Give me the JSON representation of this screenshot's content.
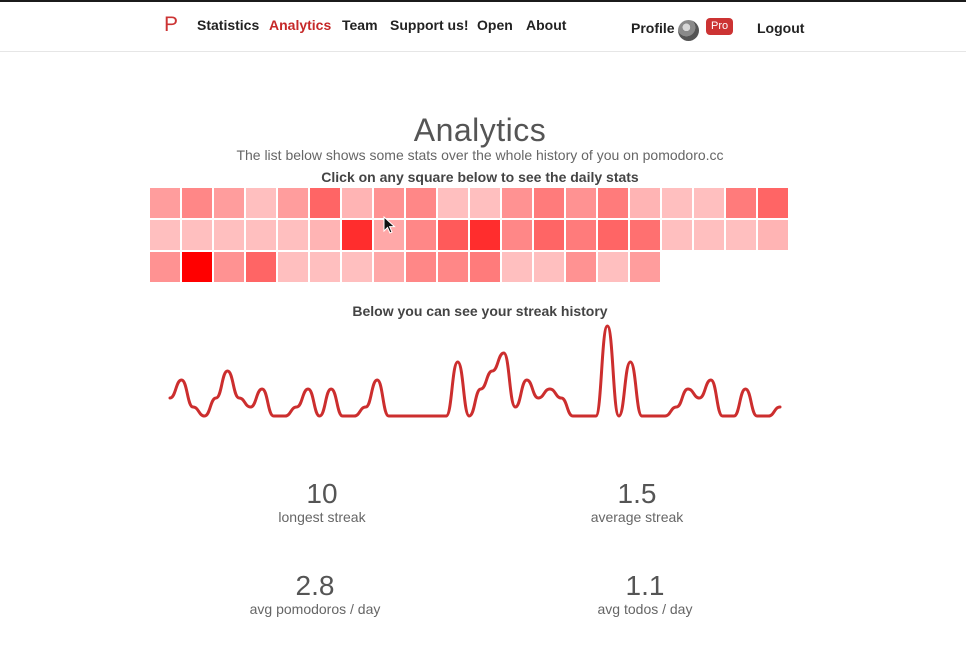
{
  "nav": {
    "logo": "P",
    "items": [
      "Statistics",
      "Analytics",
      "Team",
      "Support us!",
      "Open",
      "About"
    ],
    "active": "Analytics",
    "profile_label": "Profile",
    "pro_badge": "Pro",
    "logout_label": "Logout"
  },
  "page": {
    "title": "Analytics",
    "subtitle": "The list below shows some stats over the whole history of you on pomodoro.cc",
    "instruction": "Click on any square below to see the daily stats",
    "streak_title": "Below you can see your streak history"
  },
  "heatmap": {
    "intensity_levels": [
      [
        0.3,
        0.4,
        0.3,
        0.15,
        0.3,
        0.55,
        0.2,
        0.35,
        0.4,
        0.15,
        0.15,
        0.35,
        0.45,
        0.35,
        0.45,
        0.2,
        0.15,
        0.15,
        0.45,
        0.55
      ],
      [
        0.15,
        0.15,
        0.15,
        0.15,
        0.15,
        0.2,
        0.8,
        0.25,
        0.4,
        0.6,
        0.8,
        0.4,
        0.55,
        0.45,
        0.55,
        0.5,
        0.15,
        0.15,
        0.15,
        0.2
      ],
      [
        0.35,
        1.0,
        0.35,
        0.55,
        0.15,
        0.15,
        0.15,
        0.25,
        0.4,
        0.4,
        0.45,
        0.15,
        0.15,
        0.35,
        0.15,
        0.3
      ]
    ],
    "color": "#ff0000"
  },
  "streak_history": [
    2,
    4,
    1,
    0,
    2,
    5,
    2,
    1,
    3,
    0,
    0,
    1,
    3,
    0,
    3,
    0,
    0,
    1,
    4,
    0,
    0,
    0,
    0,
    0,
    0,
    6,
    0,
    3,
    5,
    7,
    1,
    4,
    2,
    3,
    2,
    0,
    0,
    0,
    10,
    0,
    6,
    0,
    0,
    0,
    1,
    3,
    2,
    4,
    0,
    0,
    3,
    0,
    0,
    1
  ],
  "stats": [
    {
      "value": "10",
      "label": "longest streak"
    },
    {
      "value": "1.5",
      "label": "average streak"
    },
    {
      "value": "2.8",
      "label": "avg pomodoros / day"
    },
    {
      "value": "1.1",
      "label": "avg todos / day"
    }
  ],
  "colors": {
    "accent": "#c62828",
    "line": "#cc2e2e",
    "badge": "#cc3333"
  }
}
